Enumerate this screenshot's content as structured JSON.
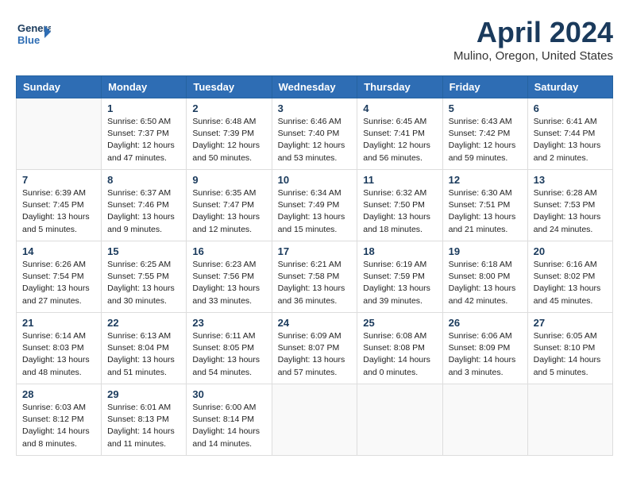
{
  "header": {
    "logo_general": "General",
    "logo_blue": "Blue",
    "month_title": "April 2024",
    "location": "Mulino, Oregon, United States"
  },
  "weekdays": [
    "Sunday",
    "Monday",
    "Tuesday",
    "Wednesday",
    "Thursday",
    "Friday",
    "Saturday"
  ],
  "weeks": [
    [
      {
        "day": "",
        "info": ""
      },
      {
        "day": "1",
        "info": "Sunrise: 6:50 AM\nSunset: 7:37 PM\nDaylight: 12 hours\nand 47 minutes."
      },
      {
        "day": "2",
        "info": "Sunrise: 6:48 AM\nSunset: 7:39 PM\nDaylight: 12 hours\nand 50 minutes."
      },
      {
        "day": "3",
        "info": "Sunrise: 6:46 AM\nSunset: 7:40 PM\nDaylight: 12 hours\nand 53 minutes."
      },
      {
        "day": "4",
        "info": "Sunrise: 6:45 AM\nSunset: 7:41 PM\nDaylight: 12 hours\nand 56 minutes."
      },
      {
        "day": "5",
        "info": "Sunrise: 6:43 AM\nSunset: 7:42 PM\nDaylight: 12 hours\nand 59 minutes."
      },
      {
        "day": "6",
        "info": "Sunrise: 6:41 AM\nSunset: 7:44 PM\nDaylight: 13 hours\nand 2 minutes."
      }
    ],
    [
      {
        "day": "7",
        "info": "Sunrise: 6:39 AM\nSunset: 7:45 PM\nDaylight: 13 hours\nand 5 minutes."
      },
      {
        "day": "8",
        "info": "Sunrise: 6:37 AM\nSunset: 7:46 PM\nDaylight: 13 hours\nand 9 minutes."
      },
      {
        "day": "9",
        "info": "Sunrise: 6:35 AM\nSunset: 7:47 PM\nDaylight: 13 hours\nand 12 minutes."
      },
      {
        "day": "10",
        "info": "Sunrise: 6:34 AM\nSunset: 7:49 PM\nDaylight: 13 hours\nand 15 minutes."
      },
      {
        "day": "11",
        "info": "Sunrise: 6:32 AM\nSunset: 7:50 PM\nDaylight: 13 hours\nand 18 minutes."
      },
      {
        "day": "12",
        "info": "Sunrise: 6:30 AM\nSunset: 7:51 PM\nDaylight: 13 hours\nand 21 minutes."
      },
      {
        "day": "13",
        "info": "Sunrise: 6:28 AM\nSunset: 7:53 PM\nDaylight: 13 hours\nand 24 minutes."
      }
    ],
    [
      {
        "day": "14",
        "info": "Sunrise: 6:26 AM\nSunset: 7:54 PM\nDaylight: 13 hours\nand 27 minutes."
      },
      {
        "day": "15",
        "info": "Sunrise: 6:25 AM\nSunset: 7:55 PM\nDaylight: 13 hours\nand 30 minutes."
      },
      {
        "day": "16",
        "info": "Sunrise: 6:23 AM\nSunset: 7:56 PM\nDaylight: 13 hours\nand 33 minutes."
      },
      {
        "day": "17",
        "info": "Sunrise: 6:21 AM\nSunset: 7:58 PM\nDaylight: 13 hours\nand 36 minutes."
      },
      {
        "day": "18",
        "info": "Sunrise: 6:19 AM\nSunset: 7:59 PM\nDaylight: 13 hours\nand 39 minutes."
      },
      {
        "day": "19",
        "info": "Sunrise: 6:18 AM\nSunset: 8:00 PM\nDaylight: 13 hours\nand 42 minutes."
      },
      {
        "day": "20",
        "info": "Sunrise: 6:16 AM\nSunset: 8:02 PM\nDaylight: 13 hours\nand 45 minutes."
      }
    ],
    [
      {
        "day": "21",
        "info": "Sunrise: 6:14 AM\nSunset: 8:03 PM\nDaylight: 13 hours\nand 48 minutes."
      },
      {
        "day": "22",
        "info": "Sunrise: 6:13 AM\nSunset: 8:04 PM\nDaylight: 13 hours\nand 51 minutes."
      },
      {
        "day": "23",
        "info": "Sunrise: 6:11 AM\nSunset: 8:05 PM\nDaylight: 13 hours\nand 54 minutes."
      },
      {
        "day": "24",
        "info": "Sunrise: 6:09 AM\nSunset: 8:07 PM\nDaylight: 13 hours\nand 57 minutes."
      },
      {
        "day": "25",
        "info": "Sunrise: 6:08 AM\nSunset: 8:08 PM\nDaylight: 14 hours\nand 0 minutes."
      },
      {
        "day": "26",
        "info": "Sunrise: 6:06 AM\nSunset: 8:09 PM\nDaylight: 14 hours\nand 3 minutes."
      },
      {
        "day": "27",
        "info": "Sunrise: 6:05 AM\nSunset: 8:10 PM\nDaylight: 14 hours\nand 5 minutes."
      }
    ],
    [
      {
        "day": "28",
        "info": "Sunrise: 6:03 AM\nSunset: 8:12 PM\nDaylight: 14 hours\nand 8 minutes."
      },
      {
        "day": "29",
        "info": "Sunrise: 6:01 AM\nSunset: 8:13 PM\nDaylight: 14 hours\nand 11 minutes."
      },
      {
        "day": "30",
        "info": "Sunrise: 6:00 AM\nSunset: 8:14 PM\nDaylight: 14 hours\nand 14 minutes."
      },
      {
        "day": "",
        "info": ""
      },
      {
        "day": "",
        "info": ""
      },
      {
        "day": "",
        "info": ""
      },
      {
        "day": "",
        "info": ""
      }
    ]
  ]
}
